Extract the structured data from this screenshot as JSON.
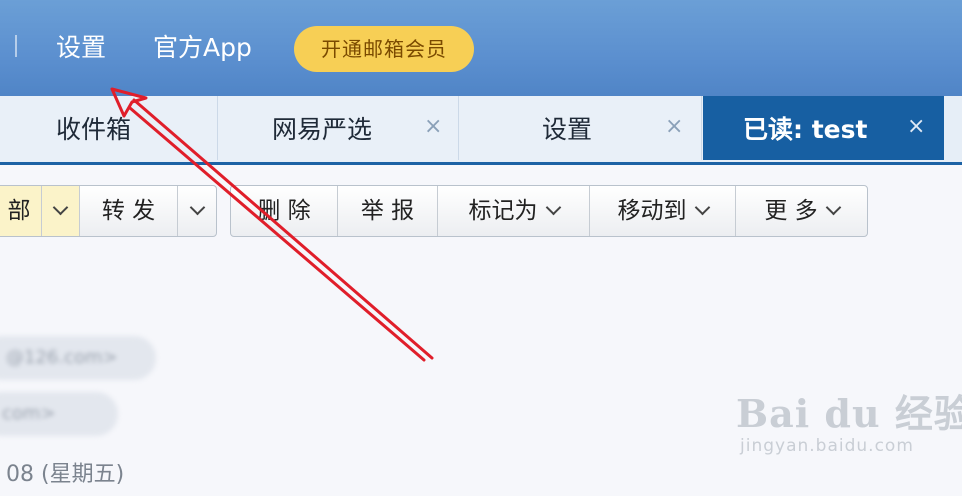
{
  "topbar": {
    "settings_label": "设置",
    "app_label": "官方App",
    "vip_label": "开通邮箱会员"
  },
  "tabs": [
    {
      "label": "收件箱",
      "closable": false,
      "active": false
    },
    {
      "label": "网易严选",
      "closable": true,
      "active": false
    },
    {
      "label": "设置",
      "closable": true,
      "active": false
    },
    {
      "label": "已读: test",
      "closable": true,
      "active": true
    }
  ],
  "close_glyph": "×",
  "toolbar": {
    "reply_all_partial": "部",
    "forward": "转 发",
    "delete": "删 除",
    "report": "举 报",
    "mark_as": "标记为",
    "move_to": "移动到",
    "more": "更 多"
  },
  "mail": {
    "sender_blurred": "@126.com>",
    "recipient_blurred": "com>",
    "date_partial": "08 (星期五)"
  },
  "watermark": {
    "brand": "Bai du 经验",
    "url": "jingyan.baidu.com"
  },
  "colors": {
    "topbar": "#5b8fcf",
    "active_tab": "#175fa2",
    "vip": "#f7cf55",
    "arrow": "#e01e2a"
  }
}
